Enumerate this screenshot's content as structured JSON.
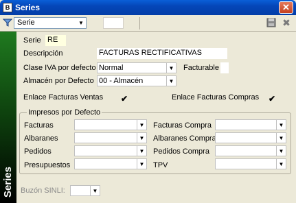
{
  "window": {
    "title": "Series",
    "app_icon_text": "B",
    "close_glyph": "✕"
  },
  "toolbar": {
    "selector_value": "Serie",
    "selector_icon": "funnel-icon",
    "save_icon": "floppy-icon",
    "close_icon": "close-icon",
    "save_glyph": "💾",
    "close_glyph": "✖",
    "arrow_glyph": "▼"
  },
  "sidebar": {
    "label": "Series",
    "gradient_top": "#1f7a1f",
    "gradient_bottom": "#000000"
  },
  "form": {
    "serie_label": "Serie",
    "serie_value": "RE",
    "descripcion_label": "Descripción",
    "descripcion_value": "FACTURAS RECTIFICATIVAS",
    "clase_iva_label": "Clase IVA por defecto",
    "clase_iva_value": "Normal",
    "facturable_label": "Facturable",
    "almacen_label": "Almacén por Defecto",
    "almacen_value": "00 - Almacén",
    "enlace_ventas_label": "Enlace Facturas Ventas",
    "enlace_ventas_checked": "✔",
    "enlace_compras_label": "Enlace Facturas Compras",
    "enlace_compras_checked": "✔"
  },
  "impresos": {
    "title": "Impresos por Defecto",
    "left": [
      {
        "label": "Facturas",
        "value": ""
      },
      {
        "label": "Albaranes",
        "value": ""
      },
      {
        "label": "Pedidos",
        "value": ""
      },
      {
        "label": "Presupuestos",
        "value": ""
      }
    ],
    "right": [
      {
        "label": "Facturas Compra",
        "value": ""
      },
      {
        "label": "Albaranes Compra",
        "value": ""
      },
      {
        "label": "Pedidos Compra",
        "value": ""
      },
      {
        "label": "TPV",
        "value": ""
      }
    ]
  },
  "buzon": {
    "label": "Buzón SINLI:",
    "value": ""
  }
}
